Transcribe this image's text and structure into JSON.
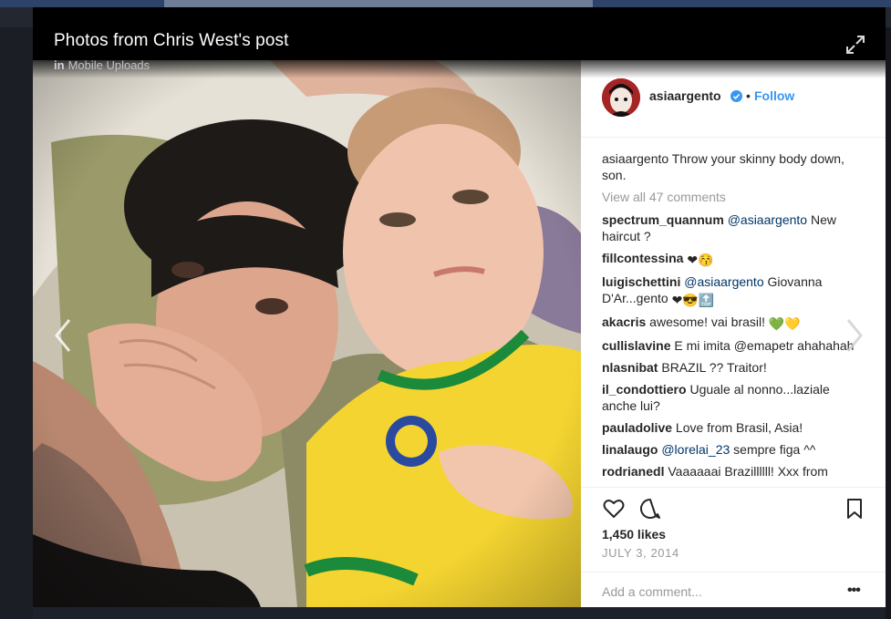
{
  "viewer": {
    "title": "Photos from Chris West's post",
    "sub_prefix": "in",
    "sub_album": "Mobile Uploads"
  },
  "instagram": {
    "username": "asiaargento",
    "dot": "•",
    "follow_label": "Follow",
    "caption": {
      "user": "asiaargento",
      "text": " Throw your skinny body down, son."
    },
    "view_all": "View all 47 comments",
    "comments": [
      {
        "user": "spectrum_quannum",
        "mention": " @asiaargento",
        "text": " New haircut ?",
        "emoji": ""
      },
      {
        "user": "fillcontessina",
        "mention": "",
        "text": " ",
        "emoji": "❤😚"
      },
      {
        "user": "luigischettini",
        "mention": " @asiaargento",
        "text": " Giovanna D'Ar...gento ",
        "emoji": "❤😎🔝"
      },
      {
        "user": "akacris",
        "mention": "",
        "text": " awesome! vai brasil! ",
        "emoji": "💚💛"
      },
      {
        "user": "cullislavine",
        "mention": "",
        "text": " E mi imita @emapetr ahahahah",
        "emoji": ""
      },
      {
        "user": "nlasnibat",
        "mention": "",
        "text": " BRAZIL ?? Traitor!",
        "emoji": ""
      },
      {
        "user": "il_condottiero",
        "mention": "",
        "text": " Uguale al nonno...laziale anche lui?",
        "emoji": ""
      },
      {
        "user": "pauladolive",
        "mention": "",
        "text": " Love from Brasil, Asia!",
        "emoji": ""
      },
      {
        "user": "linalaugo",
        "mention": " @lorelai_23",
        "text": " sempre figa ^^",
        "emoji": ""
      },
      {
        "user": "rodrianedl",
        "mention": "",
        "text": " Vaaaaaai Brazillllll! Xxx from Brazil, director @asiaargento",
        "emoji": ""
      }
    ],
    "likes": "1,450 likes",
    "date": "JULY 3, 2014",
    "add_comment_placeholder": "Add a comment...",
    "more_label": "•••"
  },
  "icons": {
    "expand": "expand-icon",
    "prev": "chevron-left-icon",
    "next": "chevron-right-icon",
    "heart": "heart-icon",
    "comment": "comment-icon",
    "bookmark": "bookmark-icon",
    "verified": "verified-badge-icon"
  },
  "colors": {
    "follow": "#3897f0",
    "viewer_bg": "#000000",
    "fb_bg": "#1d2129"
  }
}
